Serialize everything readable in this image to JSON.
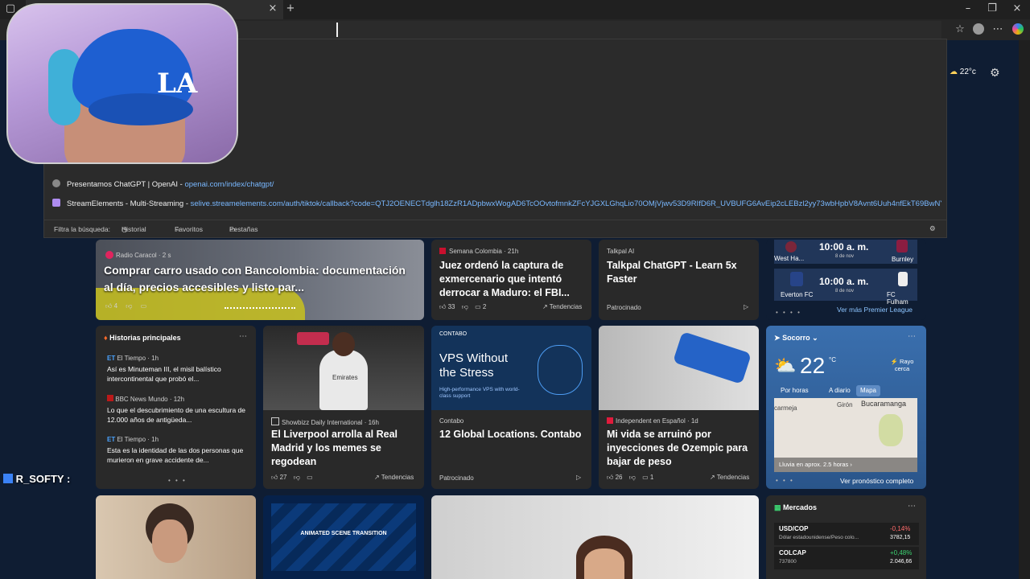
{
  "browser": {
    "weather_temp": "22°c"
  },
  "suggestions": [
    {
      "title": "Presentamos ChatGPT | OpenAI",
      "sep": " - ",
      "url": "openai.com/index/chatgpt/"
    },
    {
      "title": "StreamElements - Multi-Streaming",
      "sep": " - ",
      "url": "selive.streamelements.com/auth/tiktok/callback?code=QTJ2OENECTdglh18ZzR1ADpbwxWogAD6TcOOvtofmnkZFcYJGXLGhqLio70OMjVjwv53D9RIfD6R_UVBUFG6AvEip2cLEBzl2yy73wbHpbV8Avnt6Uuh4nfEkT69BwNYzB-jzxU5h..."
    }
  ],
  "filter": {
    "label": "Filtra la búsqueda:",
    "history": "Historial",
    "favorites": "Favoritos",
    "tabs": "Pestañas"
  },
  "news": {
    "card1": {
      "source": "Radio Caracol · 2 s",
      "title": "Comprar carro usado con Bancolombia: documentación al día, precios accesibles y listo par...",
      "likes": "4"
    },
    "card2": {
      "source": "Semana Colombia · 21h",
      "title": "Juez ordenó la captura de exmercenario que intentó derrocar a Maduro: el FBI...",
      "likes": "33",
      "comments": "2",
      "trend": "Tendencias"
    },
    "card3": {
      "source": "Talkpal AI",
      "title": "Talkpal ChatGPT - Learn 5x Faster",
      "sponsored": "Patrocinado"
    },
    "sports": {
      "match1": {
        "home": "West Ha...",
        "time": "10:00 a. m.",
        "date": "8 de nov",
        "away": "Burnley"
      },
      "match2": {
        "home": "Everton FC",
        "time": "10:00 a. m.",
        "date": "8 de nov",
        "away": "FC Fulham"
      },
      "more": "Ver más Premier League"
    },
    "top": {
      "header": "Historias principales",
      "items": [
        {
          "source": "El Tiempo · 1h",
          "text": "Así es Minuteman III, el misil balístico intercontinental que probó el..."
        },
        {
          "source": "BBC News Mundo · 12h",
          "text": "Lo que el descubrimiento de una escultura de 12.000 años de antigüeda..."
        },
        {
          "source": "El Tiempo · 1h",
          "text": "Esta es la identidad de las dos personas que murieron en grave accidente de..."
        }
      ]
    },
    "card5": {
      "source": "Showbizz Daily International · 16h",
      "title": "El Liverpool arrolla al Real Madrid y los memes se regodean",
      "likes": "27",
      "trend": "Tendencias",
      "jersey": "Emirates"
    },
    "card6": {
      "brand": "CONTABO",
      "headline": "VPS Without the Stress",
      "sub": "High-performance VPS with world-class support",
      "source": "Contabo",
      "title": "12 Global Locations. Contabo",
      "sponsored": "Patrocinado"
    },
    "card7": {
      "source": "Independent en Español · 1d",
      "title": "Mi vida se arruinó por inyecciones de Ozempic para bajar de peso",
      "likes": "26",
      "comments": "1",
      "trend": "Tendencias"
    },
    "weather": {
      "location": "Socorro",
      "temp": "22",
      "unit": "°C",
      "alert": "Rayo cerca",
      "tabs": [
        "Por horas",
        "A diario",
        "Mapa"
      ],
      "map_labels": [
        "carmeja",
        "Girón",
        "Bucaramanga"
      ],
      "rain": "Lluvia en aprox. 2.5 horas",
      "forecast": "Ver pronóstico completo"
    },
    "card9": {
      "caption": "ANIMATED SCENE TRANSITION"
    },
    "markets": {
      "header": "Mercados",
      "rows": [
        {
          "symbol": "USD/COP",
          "name": "Dólar estadounidense/Peso colo...",
          "change": "-0,14%",
          "price": "3782,15"
        },
        {
          "symbol": "COLCAP",
          "name": "737800",
          "change": "+0,48%",
          "price": "2.046,66"
        }
      ]
    }
  },
  "chat": {
    "username": "R_SOFTY :"
  }
}
